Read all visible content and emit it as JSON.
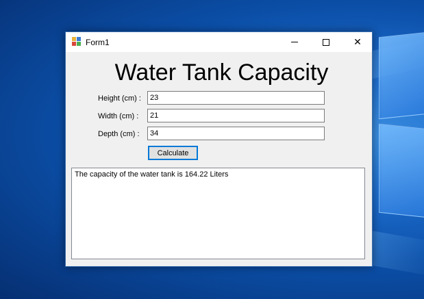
{
  "window": {
    "title": "Form1",
    "minimize_glyph": "",
    "maximize_glyph": "",
    "close_glyph": "✕"
  },
  "form": {
    "heading": "Water Tank Capacity",
    "fields": [
      {
        "label": "Height (cm) :",
        "value": "23"
      },
      {
        "label": "Width (cm) :",
        "value": "21"
      },
      {
        "label": "Depth (cm) :",
        "value": "34"
      }
    ],
    "calculate_label": "Calculate",
    "output_text": "The capacity of the water tank is 164.22 Liters"
  },
  "icons": {
    "app": "form-app-icon",
    "minimize": "minimize-icon",
    "maximize": "maximize-icon",
    "close": "close-icon"
  },
  "colors": {
    "desktop_blue": "#0b4fa8",
    "window_bg": "#f0f0f0",
    "focus_border": "#0078d7"
  }
}
